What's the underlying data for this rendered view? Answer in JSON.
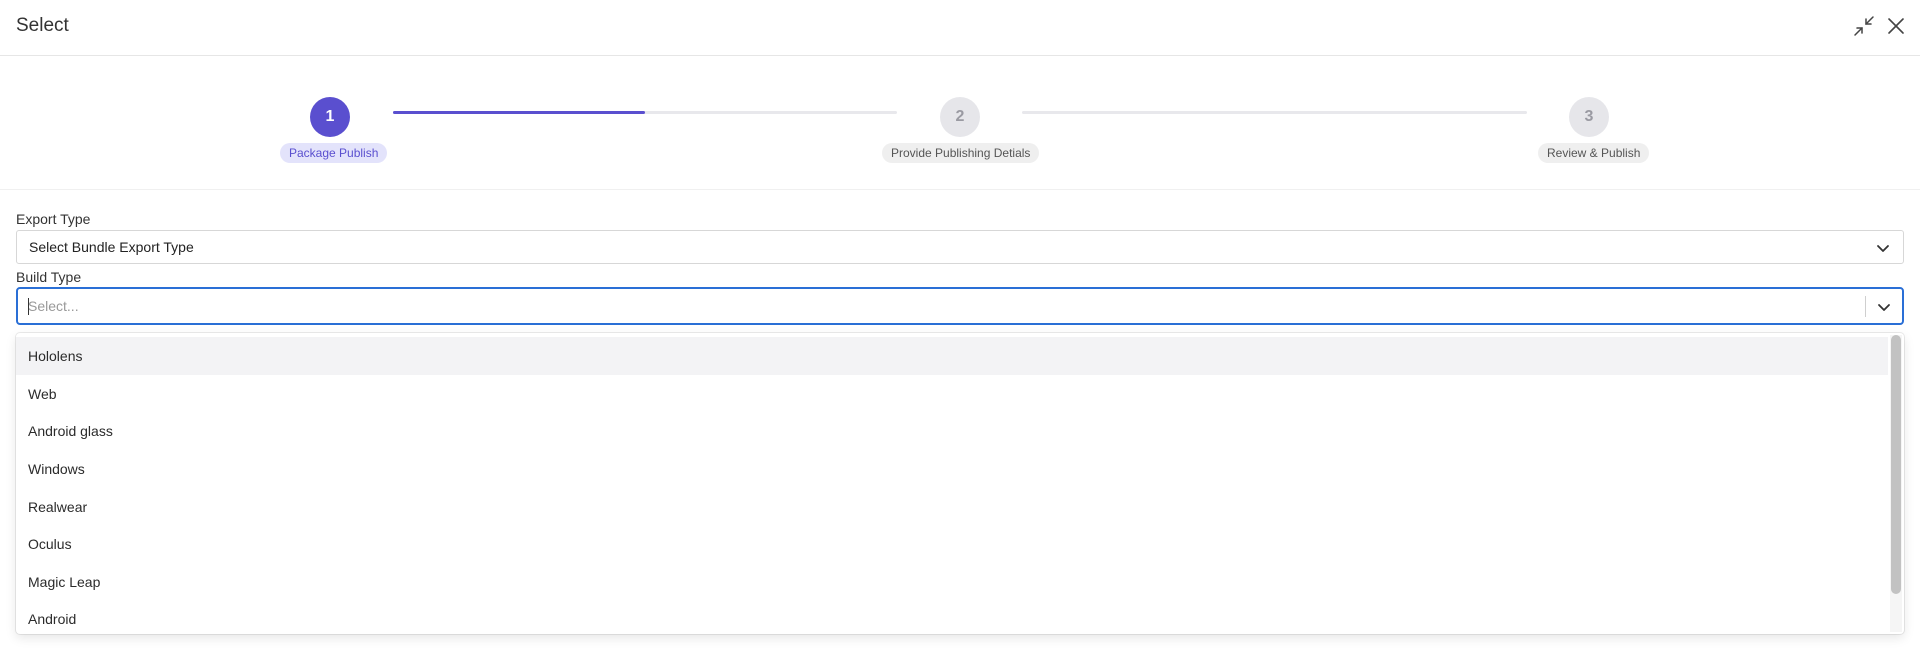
{
  "modal": {
    "title": "Select"
  },
  "icons": {
    "minimize": "minimize-icon",
    "close": "close-icon",
    "chevron": "chevron-down-icon"
  },
  "colors": {
    "accent": "#5a4fcf",
    "focus": "#2a6fd6"
  },
  "stepper": {
    "progress": 0.5,
    "steps": [
      {
        "number": "1",
        "label": "Package Publish",
        "active": true
      },
      {
        "number": "2",
        "label": "Provide Publishing Detials",
        "active": false
      },
      {
        "number": "3",
        "label": "Review & Publish",
        "active": false
      }
    ]
  },
  "form": {
    "export_type": {
      "label": "Export Type",
      "value": "Select Bundle Export Type"
    },
    "build_type": {
      "label": "Build Type",
      "placeholder": "Select..."
    }
  },
  "dropdown": {
    "options": [
      "Hololens",
      "Web",
      "Android glass",
      "Windows",
      "Realwear",
      "Oculus",
      "Magic Leap",
      "Android"
    ]
  }
}
